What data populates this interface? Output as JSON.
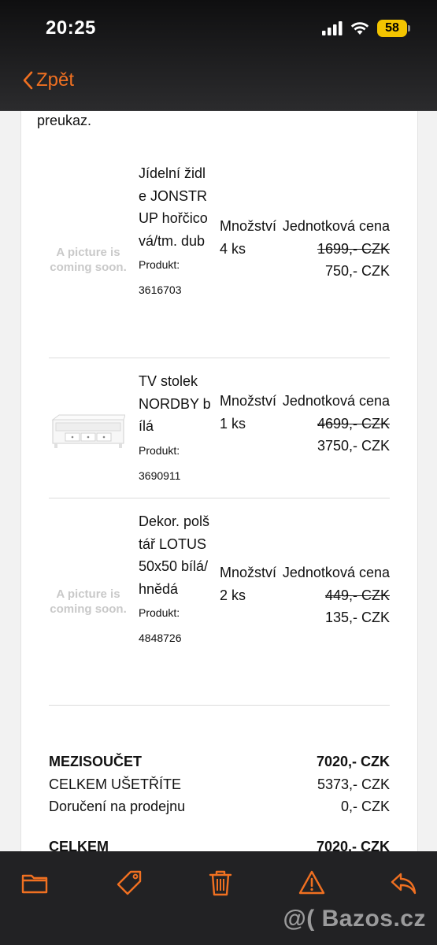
{
  "status": {
    "time": "20:25",
    "battery": "58",
    "icons": [
      "signal-icon",
      "wifi-icon",
      "battery-icon"
    ]
  },
  "nav": {
    "back_label": "Zpět"
  },
  "content": {
    "intro_tail": "preukaz.",
    "items": [
      {
        "image_placeholder": "A picture is coming soon.",
        "name": "Jídelní židle JONSTRUP hořčicová/tm. dub",
        "product_label": "Produkt:",
        "product_no": "3616703",
        "qty_label": "Množství",
        "qty": "4 ks",
        "price_label": "Jednotková cena",
        "old_price": "1699,- CZK",
        "price": "750,- CZK"
      },
      {
        "image_placeholder": "",
        "name": "TV stolek NORDBY bílá",
        "product_label": "Produkt:",
        "product_no": "3690911",
        "qty_label": "Množství",
        "qty": "1 ks",
        "price_label": "Jednotková cena",
        "old_price": "4699,- CZK",
        "price": "3750,- CZK"
      },
      {
        "image_placeholder": "A picture is coming soon.",
        "name": "Dekor. polštář LOTUS 50x50 bílá/hnědá",
        "product_label": "Produkt:",
        "product_no": "4848726",
        "qty_label": "Množství",
        "qty": "2 ks",
        "price_label": "Jednotková cena",
        "old_price": "449,- CZK",
        "price": "135,- CZK"
      }
    ],
    "totals": [
      {
        "label": "MEZISOUČET",
        "value": "7020,- CZK",
        "bold": true
      },
      {
        "label": "CELKEM UŠETŘÍTE",
        "value": "5373,- CZK",
        "bold": false
      },
      {
        "label": "Doručení na prodejnu",
        "value": "0,- CZK",
        "bold": false
      },
      {
        "label": "CELKEM",
        "value": "7020,- CZK",
        "bold": true
      }
    ]
  },
  "toolbar": {
    "icons": [
      "folder-icon",
      "tag-icon",
      "trash-icon",
      "warning-icon",
      "reply-icon"
    ],
    "accent": "#f07021"
  },
  "watermark": "@( Bazos.cz"
}
